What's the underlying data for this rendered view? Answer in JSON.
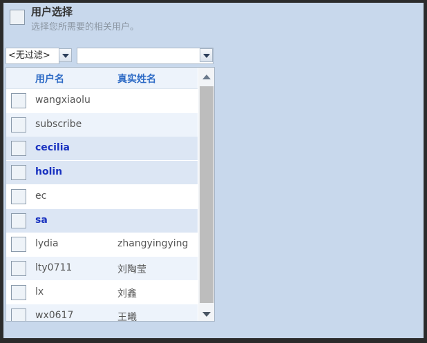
{
  "header": {
    "title": "用户选择",
    "subtitle": "选择您所需要的相关用户。"
  },
  "filter": {
    "selected": "<无过滤>"
  },
  "search": {
    "value": ""
  },
  "list": {
    "columns": [
      "用户名",
      "真实姓名"
    ],
    "rows": [
      {
        "username": "wangxiaolu",
        "real_name": "",
        "highlighted": false
      },
      {
        "username": "subscribe",
        "real_name": "",
        "highlighted": false
      },
      {
        "username": "cecilia",
        "real_name": "",
        "highlighted": true
      },
      {
        "username": "holin",
        "real_name": "",
        "highlighted": true
      },
      {
        "username": "ec",
        "real_name": "",
        "highlighted": false
      },
      {
        "username": "sa",
        "real_name": "",
        "highlighted": true
      },
      {
        "username": "lydia",
        "real_name": "zhangyingying",
        "highlighted": false
      },
      {
        "username": "lty0711",
        "real_name": "刘陶莹",
        "highlighted": false
      },
      {
        "username": "lx",
        "real_name": "刘鑫",
        "highlighted": false
      },
      {
        "username": "wx0617",
        "real_name": "王曦",
        "highlighted": false
      }
    ]
  },
  "colors": {
    "panel_bg": "#c8d8ec",
    "row_alt": "#edf3fb",
    "row_selected": "#dce6f4",
    "selected_text": "#1a33c0",
    "header_text": "#2e6bc6"
  }
}
